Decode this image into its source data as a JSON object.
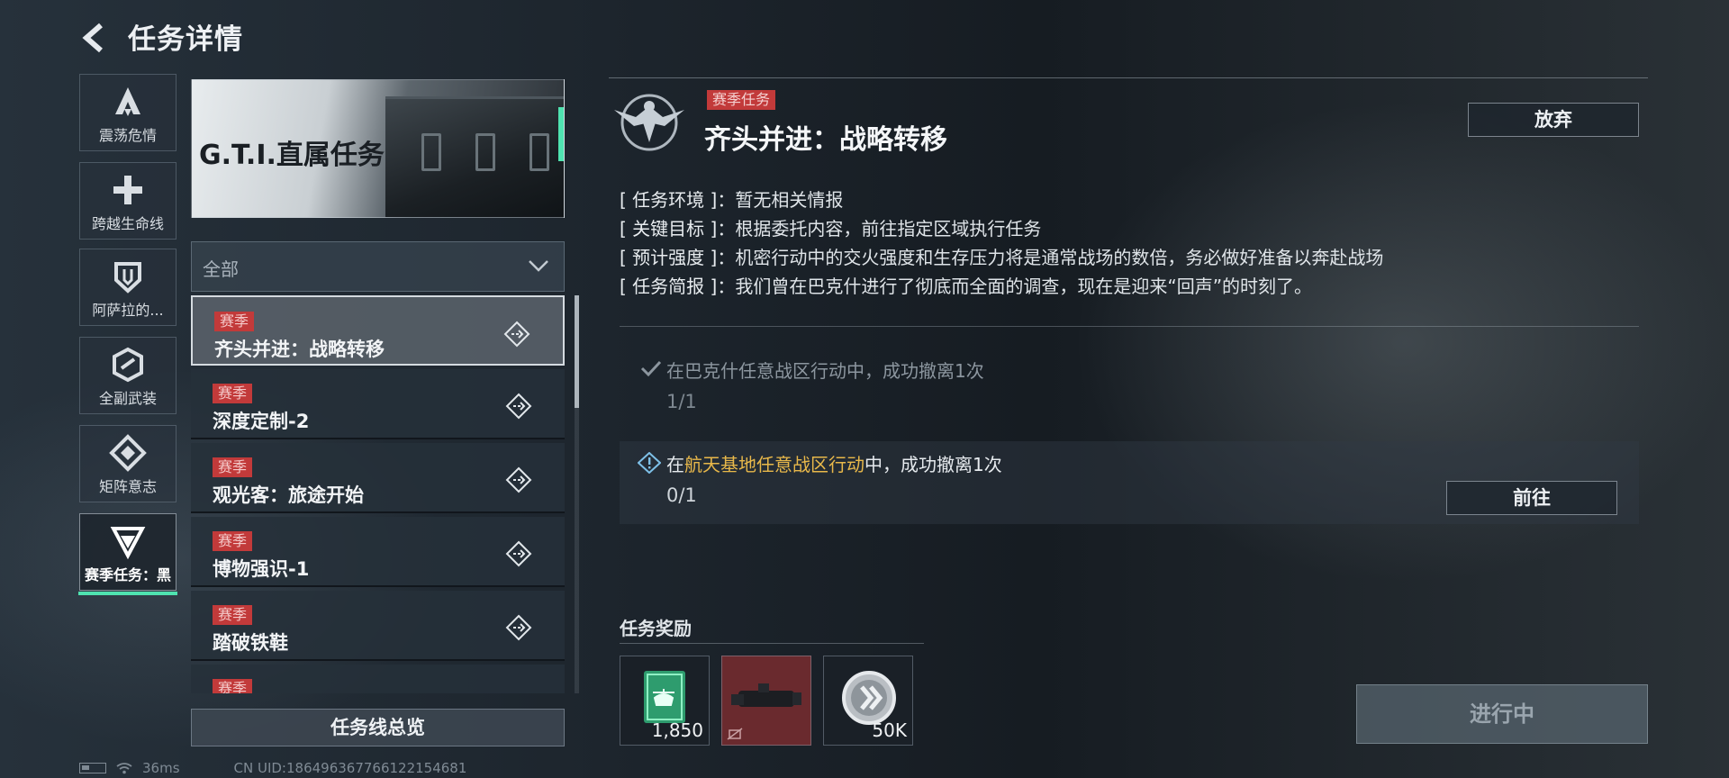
{
  "header": {
    "title": "任务详情"
  },
  "sidebar": {
    "items": [
      {
        "label": "震荡危情",
        "icon": "delta-a-icon"
      },
      {
        "label": "跨越生命线",
        "icon": "cross-icon"
      },
      {
        "label": "阿萨拉的...",
        "icon": "shield-icon"
      },
      {
        "label": "全副武装",
        "icon": "hex-icon"
      },
      {
        "label": "矩阵意志",
        "icon": "diamond-icon"
      },
      {
        "label": "赛季任务：黑",
        "icon": "triangle-icon",
        "active": true
      }
    ]
  },
  "banner": {
    "title": "G.T.I.直属任务"
  },
  "filter": {
    "selected": "全部"
  },
  "tasks": [
    {
      "badge": "赛季",
      "name": "齐头并进：战略转移",
      "selected": true
    },
    {
      "badge": "赛季",
      "name": "深度定制-2"
    },
    {
      "badge": "赛季",
      "name": "观光客：旅途开始"
    },
    {
      "badge": "赛季",
      "name": "博物强识-1"
    },
    {
      "badge": "赛季",
      "name": "踏破铁鞋"
    },
    {
      "badge": "赛季",
      "name": ""
    }
  ],
  "overview_button": "任务线总览",
  "status": {
    "ping": "36ms",
    "uid": "CN UID:1864963677661221546​81"
  },
  "detail": {
    "season_badge": "赛季任务",
    "title": "齐头并进：战略转移",
    "abandon": "放弃",
    "info": [
      {
        "key": "[ 任务环境 ]",
        "value": "：暂无相关情报"
      },
      {
        "key": "[ 关键目标 ]",
        "value": "：根据委托内容，前往指定区域执行任务"
      },
      {
        "key": "[ 预计强度 ]",
        "value": "：机密行动中的交火强度和生存压力将是通常战场的数倍，务必做好准备以奔赴战场"
      },
      {
        "key": "[ 任务简报 ]",
        "value": "：我们曾在巴克什进行了彻底而全面的调查，现在是迎来“回声”的时刻了。"
      }
    ],
    "objectives": [
      {
        "pre": "在",
        "place": "巴克什任意战区行动",
        "post": "中，成功撤离1次",
        "progress": "1/1",
        "done": true
      },
      {
        "pre": "在",
        "place": "航天基地任意战区行动",
        "post": "中，成功撤离1次",
        "progress": "0/1",
        "done": false
      }
    ],
    "goto": "前往",
    "reward_title": "任务奖励",
    "rewards": [
      {
        "qty": "1,850",
        "icon": "helicopter-card-icon"
      },
      {
        "qty": "",
        "icon": "scope-item-icon"
      },
      {
        "qty": "50K",
        "icon": "coin-icon"
      }
    ],
    "status_button": "进行中"
  }
}
